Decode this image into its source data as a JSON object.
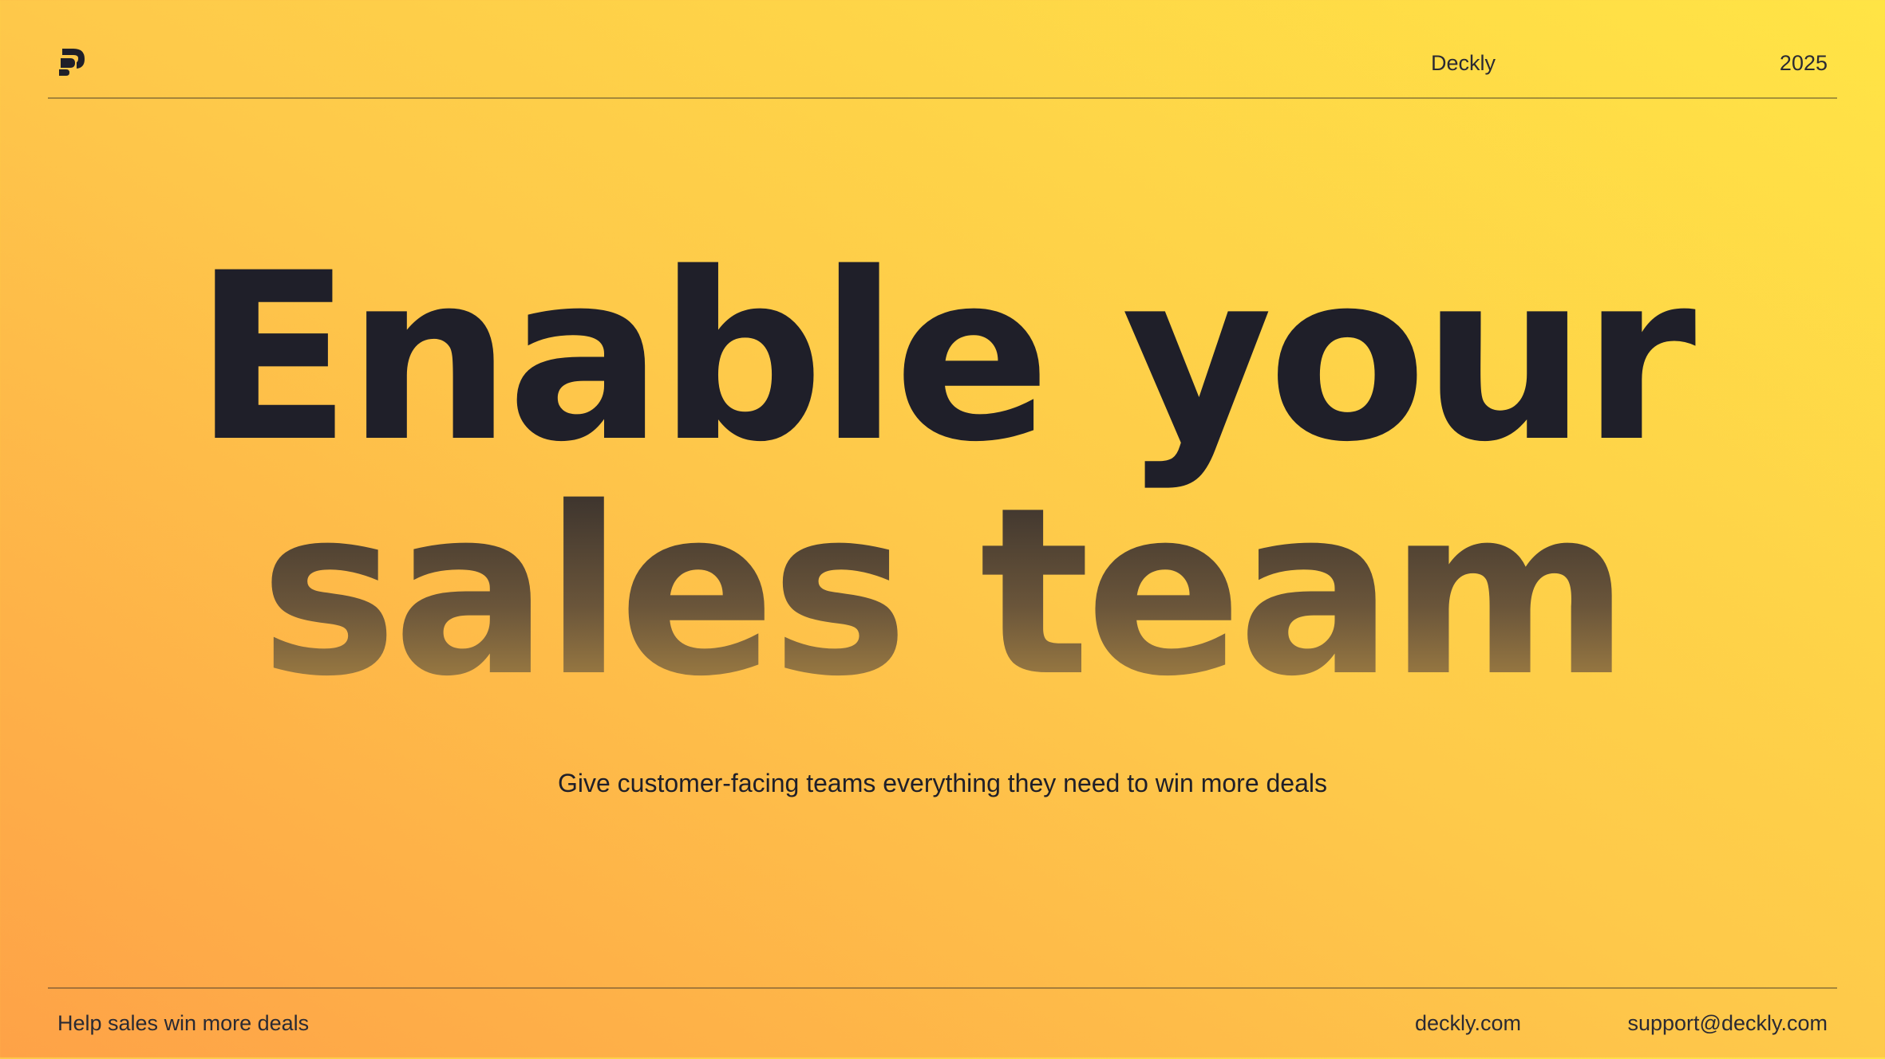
{
  "header": {
    "logo_icon": "deckly-logo-icon",
    "brand": "Deckly",
    "year": "2025"
  },
  "hero": {
    "line1": "Enable your",
    "line2": "sales team",
    "subtitle": "Give customer-facing teams everything they need to win more deals"
  },
  "footer": {
    "tagline": "Help sales win more deals",
    "website": "deckly.com",
    "email": "support@deckly.com"
  },
  "colors": {
    "text": "#1f1f29",
    "gradient_start": "#fea247",
    "gradient_end": "#ffe445"
  }
}
